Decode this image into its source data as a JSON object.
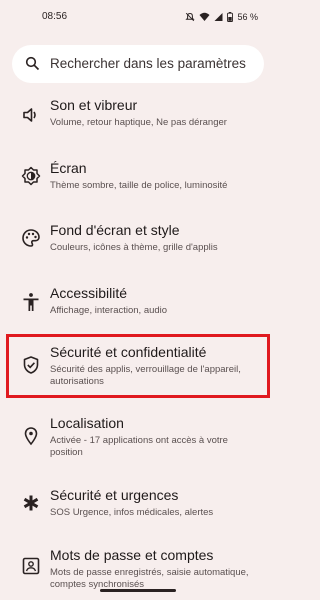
{
  "status": {
    "time": "08:56",
    "battery": "56 %"
  },
  "search": {
    "placeholder": "Rechercher dans les paramètres"
  },
  "items": [
    {
      "title": "Son et vibreur",
      "subtitle": "Volume, retour haptique, Ne pas déranger",
      "icon": "volume-icon"
    },
    {
      "title": "Écran",
      "subtitle": "Thème sombre, taille de police, luminosité",
      "icon": "brightness-icon"
    },
    {
      "title": "Fond d'écran et style",
      "subtitle": "Couleurs, icônes à thème, grille d'applis",
      "icon": "palette-icon"
    },
    {
      "title": "Accessibilité",
      "subtitle": "Affichage, interaction, audio",
      "icon": "accessibility-icon"
    },
    {
      "title": "Sécurité et confidentialité",
      "subtitle": "Sécurité des applis, verrouillage de l'appareil, autorisations",
      "icon": "shield-check-icon"
    },
    {
      "title": "Localisation",
      "subtitle": "Activée - 17 applications ont accès à votre position",
      "icon": "location-pin-icon"
    },
    {
      "title": "Sécurité et urgences",
      "subtitle": "SOS Urgence, infos médicales, alertes",
      "icon": "emergency-asterisk-icon"
    },
    {
      "title": "Mots de passe et comptes",
      "subtitle": "Mots de passe enregistrés, saisie automatique, comptes synchronisés",
      "icon": "account-box-icon"
    }
  ],
  "colors": {
    "background": "#f7eeed",
    "highlight": "#e0191f"
  }
}
